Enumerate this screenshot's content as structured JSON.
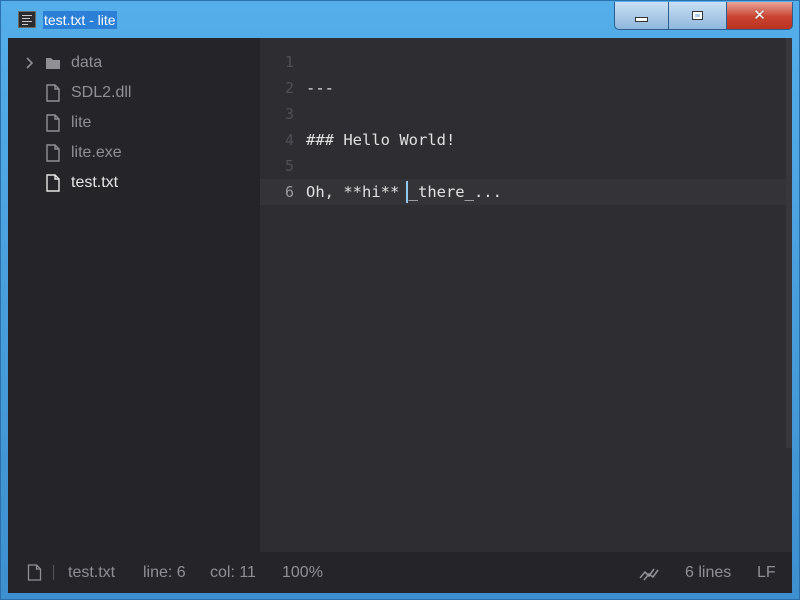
{
  "window": {
    "title": "test.txt - lite"
  },
  "sidebar": {
    "items": [
      {
        "label": "data",
        "type": "folder",
        "icon": "folder-icon"
      },
      {
        "label": "SDL2.dll",
        "type": "file",
        "icon": "file-icon"
      },
      {
        "label": "lite",
        "type": "file",
        "icon": "file-icon"
      },
      {
        "label": "lite.exe",
        "type": "file",
        "icon": "file-icon"
      },
      {
        "label": "test.txt",
        "type": "file",
        "icon": "file-icon",
        "active": true
      }
    ]
  },
  "editor": {
    "lines": [
      {
        "number": "1",
        "text": ""
      },
      {
        "number": "2",
        "text": "---"
      },
      {
        "number": "3",
        "text": ""
      },
      {
        "number": "4",
        "text": "### Hello World!"
      },
      {
        "number": "5",
        "text": ""
      },
      {
        "number": "6",
        "text": "Oh, **hi** _there_...",
        "current": true
      }
    ]
  },
  "status": {
    "file": "test.txt",
    "line": "line: 6",
    "col": "col: 11",
    "zoom": "100%",
    "line_count": "6 lines",
    "line_ending": "LF"
  },
  "colors": {
    "background": "#2e2e32",
    "sidebar": "#252529",
    "caret": "#93c9f0",
    "text": "#e0e0e0"
  }
}
